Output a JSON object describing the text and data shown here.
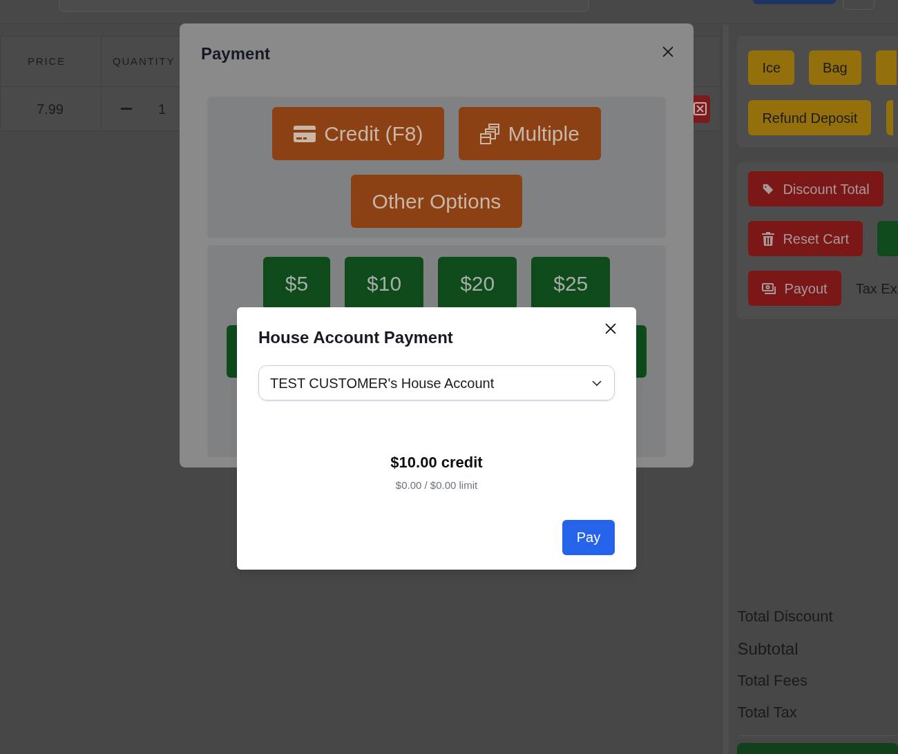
{
  "table": {
    "columns": [
      "PRICE",
      "QUANTITY"
    ],
    "rows": [
      {
        "price": "7.99",
        "quantity": "1"
      }
    ]
  },
  "side_panel": {
    "quick_buttons": [
      "Ice",
      "Bag"
    ],
    "wide_buttons": [
      "Refund Deposit"
    ],
    "actions": [
      {
        "label": "Discount Total",
        "kind": "tag"
      },
      {
        "label": "Reset Cart",
        "kind": "trash"
      },
      {
        "label": "Payout",
        "kind": "cash"
      }
    ],
    "tax_exempt_label": "Tax Ex",
    "totals": [
      "Total Discount",
      "Subtotal",
      "Total Fees",
      "Total Tax"
    ]
  },
  "payment_dialog": {
    "title": "Payment",
    "methods": [
      {
        "label": "Credit (F8)",
        "kind": "card"
      },
      {
        "label": "Multiple",
        "kind": "split"
      },
      {
        "label": "Other Options",
        "kind": "plain"
      }
    ],
    "cash_amounts": [
      "$5",
      "$10",
      "$20",
      "$25"
    ]
  },
  "house_account_dialog": {
    "title": "House Account Payment",
    "account_select": {
      "value": "TEST CUSTOMER's House Account"
    },
    "credit": "$10.00 credit",
    "limit": "$0.00 / $0.00 limit",
    "pay_button": "Pay"
  }
}
